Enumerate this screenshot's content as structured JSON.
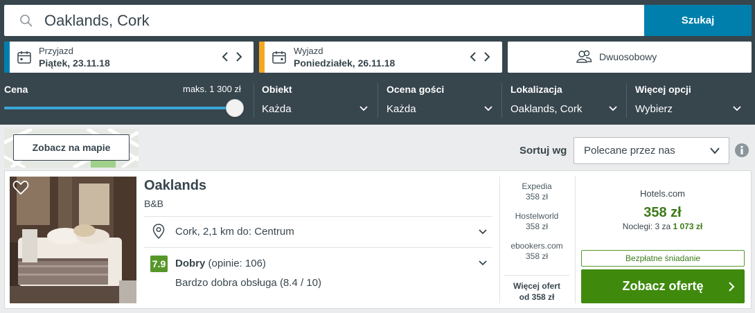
{
  "search": {
    "value": "Oaklands, Cork",
    "button_label": "Szukaj",
    "colors": {
      "button": "#007fad"
    }
  },
  "checkin": {
    "label": "Przyjazd",
    "value": "Piątek, 23.11.18",
    "accent": "#007fad"
  },
  "checkout": {
    "label": "Wyjazd",
    "value": "Poniedziałek, 26.11.18",
    "accent": "#f5a623"
  },
  "room": {
    "value": "Dwuosobowy",
    "icon": "guests-icon"
  },
  "filters": {
    "price": {
      "title": "Cena",
      "max_label": "maks. 1 300 zł",
      "slider_fraction": 1.0
    },
    "property": {
      "title": "Obiekt",
      "value": "Każda"
    },
    "guest_rating": {
      "title": "Ocena gości",
      "value": "Każda"
    },
    "location": {
      "title": "Lokalizacja",
      "value": "Oaklands, Cork"
    },
    "more": {
      "title": "Więcej opcji",
      "value": "Wybierz"
    }
  },
  "map": {
    "button_label": "Zobacz na mapie"
  },
  "sort": {
    "label": "Sortuj wg",
    "value": "Polecane przez nas"
  },
  "hotel": {
    "name": "Oaklands",
    "type": "B&B",
    "location": "Cork, 2,1 km do: Centrum",
    "score": "7.9",
    "rating_word": "Dobry",
    "rating_count": "(opinie: 106)",
    "highlight": "Bardzo dobra obsługa (8.4 / 10)",
    "partners": [
      {
        "name": "Expedia",
        "price": "358 zł"
      },
      {
        "name": "Hostelworld",
        "price": "358 zł"
      },
      {
        "name": "ebookers.com",
        "price": "358 zł"
      }
    ],
    "more_offers_line1": "Więcej ofert",
    "more_offers_line2": "od 358 zł",
    "deal": {
      "site": "Hotels.com",
      "price": "358 zł",
      "nights_prefix": "Noclegi: 3 za",
      "nights_total": "1 073 zł",
      "badge": "Bezpłatne śniadanie",
      "cta": "Zobacz ofertę"
    }
  }
}
